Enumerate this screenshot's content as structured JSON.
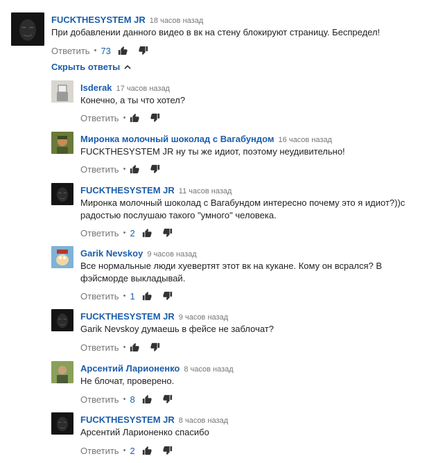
{
  "parent": {
    "author": "FUCKTHESYSTEM JR",
    "time": "18 часов назад",
    "text": "При добавлении данного видео в вк на стену блокируют страницу. Беспредел!",
    "reply_label": "Ответить",
    "likes": "73"
  },
  "toggle_label": "Скрыть ответы",
  "replies": [
    {
      "author": "Isderak",
      "time": "17 часов назад",
      "text": "Конечно, а ты что хотел?",
      "reply_label": "Ответить",
      "likes": ""
    },
    {
      "author": "Миронка молочный шоколад с Вагабундом",
      "time": "16 часов назад",
      "text": "FUCKTHESYSTEM JR ну ты же идиот, поэтому неудивительно!",
      "reply_label": "Ответить",
      "likes": ""
    },
    {
      "author": "FUCKTHESYSTEM JR",
      "time": "11 часов назад",
      "text": "Миронка молочный шоколад с Вагабундом интересно почему это я идиот?))с радостью послушаю такого \"умного\" человека.",
      "reply_label": "Ответить",
      "likes": "2"
    },
    {
      "author": "Garik Nevskoy",
      "time": "9 часов назад",
      "text": "Все нормальные люди хуевертят этот вк на кукане. Кому он всрался? В фэйсморде выкладывай.",
      "reply_label": "Ответить",
      "likes": "1"
    },
    {
      "author": "FUCKTHESYSTEM JR",
      "time": "9 часов назад",
      "text": "Garik Nevskoy думаешь в фейсе не заблочат?",
      "reply_label": "Ответить",
      "likes": ""
    },
    {
      "author": "Арсентий Ларионенко",
      "time": "8 часов назад",
      "text": "Не блочат, проверено.",
      "reply_label": "Ответить",
      "likes": "8"
    },
    {
      "author": "FUCKTHESYSTEM JR",
      "time": "8 часов назад",
      "text": "Арсентий Ларионенко спасибо",
      "reply_label": "Ответить",
      "likes": "2"
    }
  ],
  "colors": {
    "link": "#1a5dab",
    "meta": "#767676",
    "text": "#222222"
  }
}
